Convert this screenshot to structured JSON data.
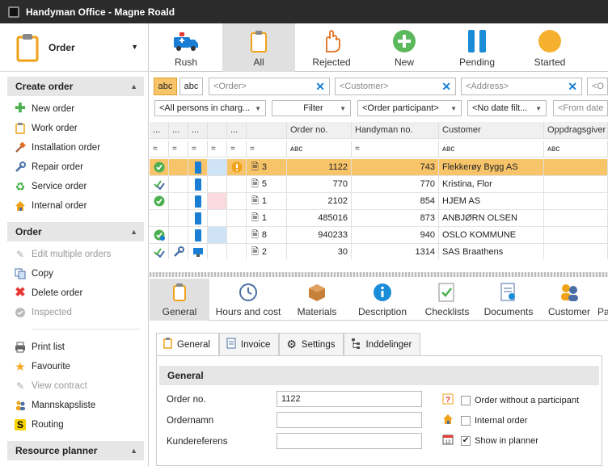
{
  "window": {
    "title": "Handyman Office - Magne Roald"
  },
  "left": {
    "module": "Order",
    "sections": [
      {
        "title": "Create order",
        "items": [
          {
            "label": "New order",
            "icon": "plus-icon",
            "disabled": false
          },
          {
            "label": "Work order",
            "icon": "clipboard-icon",
            "disabled": false
          },
          {
            "label": "Installation order",
            "icon": "hammer-icon",
            "disabled": false
          },
          {
            "label": "Repair order",
            "icon": "wrench-icon",
            "disabled": false
          },
          {
            "label": "Service order",
            "icon": "recycle-icon",
            "disabled": false
          },
          {
            "label": "Internal order",
            "icon": "house-icon",
            "disabled": false
          }
        ]
      },
      {
        "title": "Order",
        "items": [
          {
            "label": "Edit multiple orders",
            "icon": "edit-icon",
            "disabled": true
          },
          {
            "label": "Copy",
            "icon": "copy-icon",
            "disabled": false
          },
          {
            "label": "Delete order",
            "icon": "delete-icon",
            "disabled": false
          },
          {
            "label": "Inspected",
            "icon": "check-icon",
            "disabled": true
          }
        ]
      },
      {
        "title": "",
        "items": [
          {
            "label": "Print list",
            "icon": "printer-icon",
            "disabled": false
          },
          {
            "label": "Favourite",
            "icon": "star-icon",
            "disabled": false
          },
          {
            "label": "View contract",
            "icon": "contract-icon",
            "disabled": true
          },
          {
            "label": "Mannskapsliste",
            "icon": "team-icon",
            "disabled": false
          },
          {
            "label": "Routing",
            "icon": "routing-icon",
            "disabled": false
          }
        ]
      },
      {
        "title": "Resource planner",
        "items": []
      }
    ]
  },
  "toolbar": {
    "buttons": [
      {
        "label": "Rush",
        "icon": "ambulance-icon"
      },
      {
        "label": "All",
        "icon": "clipboard-icon",
        "active": true
      },
      {
        "label": "Rejected",
        "icon": "hand-icon"
      },
      {
        "label": "New",
        "icon": "plus-circle-icon"
      },
      {
        "label": "Pending",
        "icon": "pause-icon"
      },
      {
        "label": "Started",
        "icon": "circle-icon"
      }
    ]
  },
  "filters": {
    "abc1": "abc",
    "abc2": "abc",
    "order_placeholder": "<Order>",
    "customer_placeholder": "<Customer>",
    "address_placeholder": "<Address>",
    "extra_placeholder": "<O",
    "persons": "<All persons in charg...",
    "filter": "Filter",
    "participant": "<Order participant>",
    "date_filter": "<No date filt...",
    "from_date": "<From date"
  },
  "grid": {
    "columns": [
      "...",
      "...",
      "...",
      "",
      "...",
      "",
      "Order no.",
      "Handyman no.",
      "Customer",
      "Oppdragsgiver"
    ],
    "filter_glyphs": [
      "=",
      "=",
      "=",
      "=",
      "=",
      "=",
      "ᴀʙc",
      "=",
      "ᴀʙc",
      "ᴀʙc"
    ],
    "rows": [
      {
        "num": "3",
        "order_no": "1122",
        "handyman_no": "743",
        "customer": "Flekkerøy Bygg AS",
        "selected": true
      },
      {
        "num": "5",
        "order_no": "770",
        "handyman_no": "770",
        "customer": "Kristina, Flor",
        "selected": false
      },
      {
        "num": "1",
        "order_no": "2102",
        "handyman_no": "854",
        "customer": "HJEM AS",
        "selected": false
      },
      {
        "num": "1",
        "order_no": "485016",
        "handyman_no": "873",
        "customer": "ANBJØRN OLSEN",
        "selected": false
      },
      {
        "num": "8",
        "order_no": "940233",
        "handyman_no": "940",
        "customer": "OSLO KOMMUNE",
        "selected": false
      },
      {
        "num": "2",
        "order_no": "30",
        "handyman_no": "1314",
        "customer": "SAS Braathens",
        "selected": false
      }
    ]
  },
  "detail_tabs": [
    {
      "label": "General",
      "icon": "clipboard-icon",
      "active": true
    },
    {
      "label": "Hours and cost",
      "icon": "clock-icon"
    },
    {
      "label": "Materials",
      "icon": "box-icon"
    },
    {
      "label": "Description",
      "icon": "info-icon"
    },
    {
      "label": "Checklists",
      "icon": "checklist-icon"
    },
    {
      "label": "Documents",
      "icon": "documents-icon"
    },
    {
      "label": "Customer",
      "icon": "customer-icon"
    },
    {
      "label": "Pa",
      "icon": ""
    }
  ],
  "sub_tabs": [
    {
      "label": "General",
      "icon": "clipboard-icon",
      "active": true
    },
    {
      "label": "Invoice",
      "icon": "invoice-icon"
    },
    {
      "label": "Settings",
      "icon": "gear-icon"
    },
    {
      "label": "Inddelinger",
      "icon": "tree-icon"
    }
  ],
  "general": {
    "title": "General",
    "order_no_label": "Order no.",
    "order_no": "1122",
    "ordernamn_label": "Ordernamn",
    "ordernamn": "",
    "kundereferens_label": "Kundereferens",
    "kundereferens": "",
    "chk_no_participant": "Order without a participant",
    "chk_internal": "Internal order",
    "chk_planner": "Show in planner"
  }
}
